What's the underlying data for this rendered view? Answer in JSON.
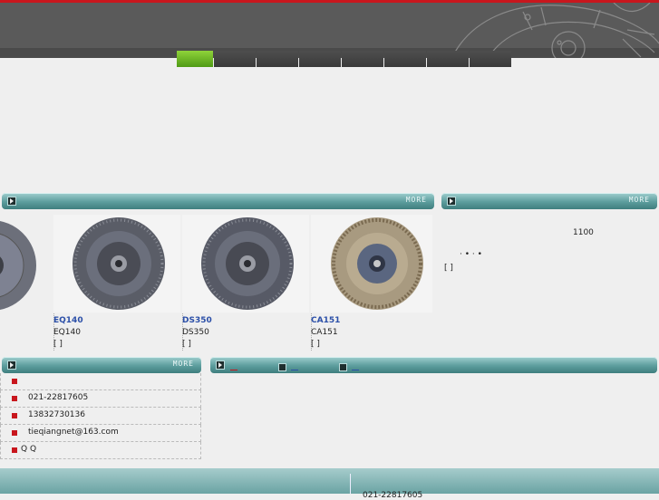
{
  "header": {
    "nav_tabs": [
      "",
      "",
      "",
      "",
      "",
      "",
      "",
      ""
    ]
  },
  "products_panel": {
    "more_label": "MORE",
    "items": [
      {
        "code": "EQ140",
        "name": "EQ140",
        "link": "[      ]"
      },
      {
        "code": "DS350",
        "name": "DS350",
        "link": "[      ]"
      },
      {
        "code": "CA151",
        "name": "CA151",
        "link": "[      ]"
      }
    ]
  },
  "about_panel": {
    "more_label": "MORE",
    "number": "1100",
    "dots": "·  •         ·  •",
    "link": "[      ]"
  },
  "contact_panel": {
    "more_label": "MORE",
    "rows": [
      "",
      "021-22817605",
      "13832730136",
      "tieqiangnet@163.com",
      "Q Q"
    ]
  },
  "footer": {
    "phone": "021-22817605"
  },
  "colors": {
    "brand_red": "#c8161d",
    "accent_green": "#6db72a",
    "teal_bar": "#5c9d9d",
    "link_blue": "#2b4fa8"
  }
}
